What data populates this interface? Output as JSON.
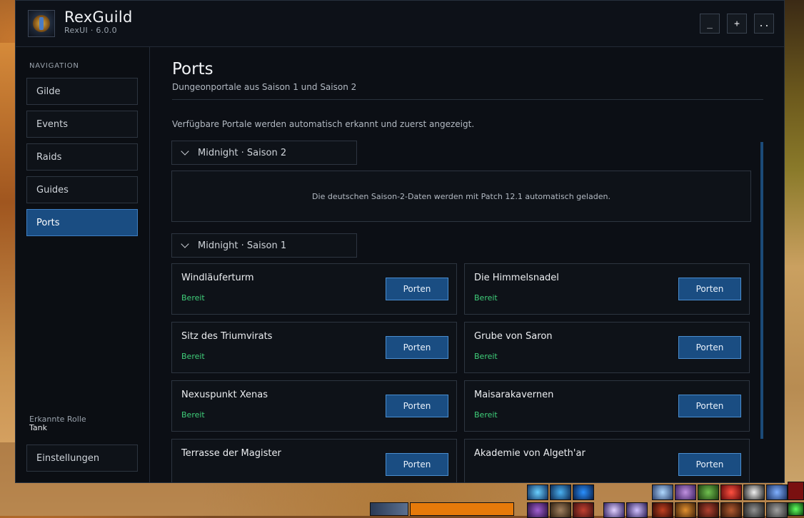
{
  "app": {
    "title": "RexGuild",
    "version": "RexUI · 6.0.0"
  },
  "window_controls": {
    "minimize": "_",
    "expand": "+",
    "more": ".."
  },
  "sidebar": {
    "heading": "NAVIGATION",
    "items": [
      {
        "label": "Gilde",
        "active": false
      },
      {
        "label": "Events",
        "active": false
      },
      {
        "label": "Raids",
        "active": false
      },
      {
        "label": "Guides",
        "active": false
      },
      {
        "label": "Ports",
        "active": true
      }
    ],
    "role_label": "Erkannte Rolle",
    "role_value": "Tank",
    "settings_label": "Einstellungen"
  },
  "main": {
    "title": "Ports",
    "subtitle": "Dungeonportale aus Saison 1 und Saison 2",
    "info": "Verfügbare Portale werden automatisch erkannt und zuerst angezeigt.",
    "season2": {
      "header": "Midnight · Saison 2",
      "notice": "Die deutschen Saison-2-Daten werden mit Patch 12.1 automatisch geladen."
    },
    "season1": {
      "header": "Midnight · Saison 1",
      "dungeons": [
        {
          "name": "Windläuferturm",
          "status": "Bereit",
          "button": "Porten"
        },
        {
          "name": "Die Himmelsnadel",
          "status": "Bereit",
          "button": "Porten"
        },
        {
          "name": "Sitz des Triumvirats",
          "status": "Bereit",
          "button": "Porten"
        },
        {
          "name": "Grube von Saron",
          "status": "Bereit",
          "button": "Porten"
        },
        {
          "name": "Nexuspunkt Xenas",
          "status": "Bereit",
          "button": "Porten"
        },
        {
          "name": "Maisarakavernen",
          "status": "Bereit",
          "button": "Porten"
        },
        {
          "name": "Terrasse der Magister",
          "status": "",
          "button": "Porten"
        },
        {
          "name": "Akademie von Algeth'ar",
          "status": "",
          "button": "Porten"
        }
      ]
    }
  },
  "colors": {
    "accent": "#1a4d82",
    "accent_border": "#4a8ed0",
    "status_ready": "#3fce79",
    "window_bg": "#0c0f15"
  }
}
